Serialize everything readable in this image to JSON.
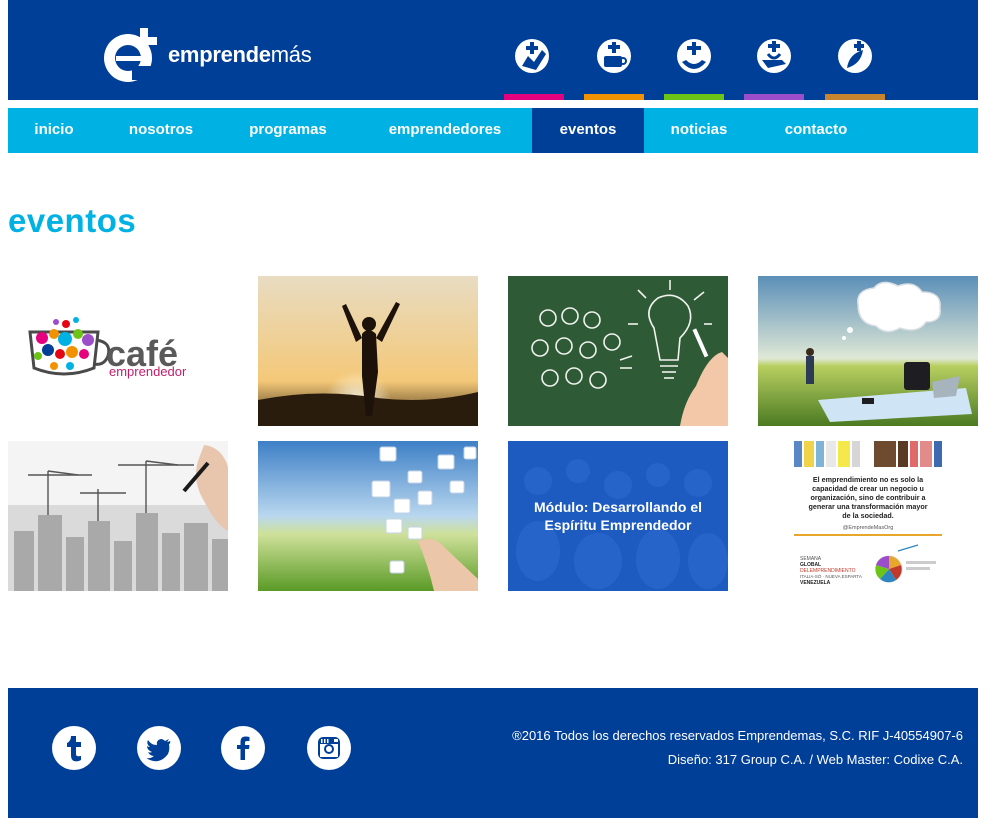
{
  "header": {
    "logo_name": "emprende",
    "logo_accent": "más",
    "categories": [
      {
        "icon": "hand-plus-icon",
        "color": "#e6007e"
      },
      {
        "icon": "cup-plus-icon",
        "color": "#f39200"
      },
      {
        "icon": "hands-plus-icon",
        "color": "#6cc417"
      },
      {
        "icon": "hand-heart-plus-icon",
        "color": "#9b4dca"
      },
      {
        "icon": "leaf-plus-icon",
        "color": "#c9852e"
      }
    ]
  },
  "nav": {
    "items": [
      "inicio",
      "nosotros",
      "programas",
      "emprendedores",
      "eventos",
      "noticias",
      "contacto"
    ],
    "active": "eventos"
  },
  "main": {
    "title": "eventos",
    "tiles": [
      {
        "name": "cafe-emprendedor",
        "logo_word": "café",
        "logo_sub": "emprendedor"
      },
      {
        "name": "silhouette-sunset"
      },
      {
        "name": "lightbulbs-chalkboard"
      },
      {
        "name": "businessman-field"
      },
      {
        "name": "city-sketch"
      },
      {
        "name": "puzzle-sky"
      },
      {
        "name": "modulo-espiritu",
        "caption": "Módulo: Desarrollando el Espíritu Emprendedor"
      },
      {
        "name": "semana-global",
        "quote": "El emprendimiento no es solo la capacidad de crear un negocio u organización, sino de contribuir a generar una transformación mayor de la sociedad.",
        "handle": "@EmprendeMasOrg",
        "event_lines": [
          "SEMANA",
          "GLOBAL",
          "DELEMPRENDIMIENTO",
          "ITALIA-SÓ · NUEVA ESPARTA",
          "VENEZUELA"
        ]
      }
    ]
  },
  "footer": {
    "social": [
      "tumblr-icon",
      "twitter-icon",
      "facebook-icon",
      "instagram-icon"
    ],
    "copyright": "®2016 Todos los derechos reservados Emprendemas, S.C. RIF J-40554907-6",
    "credits": "Diseño: 317 Group C.A. / Web Master: Codixe C.A."
  },
  "colors": {
    "brand_blue": "#003f98",
    "accent_cyan": "#00b2e3",
    "white": "#ffffff"
  }
}
